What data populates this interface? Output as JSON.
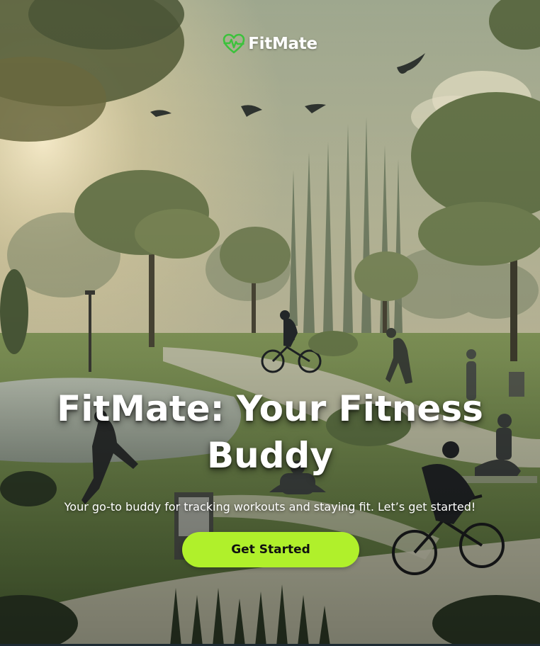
{
  "brand": {
    "name": "FitMate",
    "icon": "heart-pulse-icon",
    "icon_color": "#3cc23c"
  },
  "hero": {
    "headline": "FitMate: Your Fitness Buddy",
    "subtitle": "Your go-to buddy for tracking workouts and staying fit. Let’s get started!",
    "background": "park-scene-illustration"
  },
  "cta": {
    "label": "Get Started",
    "color": "#b0f02b"
  }
}
